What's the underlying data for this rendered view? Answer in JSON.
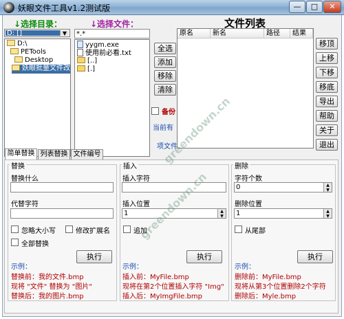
{
  "window": {
    "title": "妖眼文件工具v1.2测试版",
    "controls": {
      "minimize": "—",
      "maximize": "□",
      "close": "✕"
    }
  },
  "directory": {
    "label": "↓选择目录：",
    "drive": "D: []",
    "tree": [
      "D:\\",
      "PETools",
      "Desktop",
      "妖眼批量文件改名"
    ]
  },
  "files": {
    "label": "↓选择文件：",
    "filter": "*.*",
    "items": [
      "yygm.exe",
      "使用前必看.txt",
      "[..]",
      "[.]"
    ]
  },
  "middle_buttons": [
    "全选",
    "添加",
    "移除",
    "清除"
  ],
  "backup": {
    "label": "备份"
  },
  "current_label": "当前有",
  "current_label2": "项文件",
  "file_list": {
    "title": "文件列表",
    "columns": [
      "原名",
      "新名",
      "路径",
      "结果"
    ]
  },
  "right_buttons": [
    "移顶",
    "上移",
    "下移",
    "移底",
    "导出",
    "帮助",
    "关于",
    "退出"
  ],
  "tabs": [
    "简单替换",
    "列表替换",
    "文件编号"
  ],
  "replace": {
    "group": "替换",
    "replace_what": "替换什么",
    "replace_with": "代替字符",
    "ignore_case": "忽略大小写",
    "modify_ext": "修改扩展名",
    "replace_all": "全部替换",
    "exec": "执行",
    "example_title": "示例：",
    "ex1": "替换前：我的文件.bmp",
    "ex2": "现将 \"文件\" 替换为 \"图片\"",
    "ex3": "替换后：我的图片.bmp"
  },
  "insert": {
    "group": "插入",
    "chars": "插入字符",
    "position": "插入位置",
    "position_value": "1",
    "append": "追加",
    "exec": "执行",
    "example_title": "示例：",
    "ex1": "插入前：MyFile.bmp",
    "ex2": "现将在第2个位置插入字符 \"Img\"",
    "ex3": "插入后：MyImgFile.bmp"
  },
  "delete": {
    "group": "删除",
    "count": "字符个数",
    "count_value": "0",
    "position": "删除位置",
    "position_value": "1",
    "from_end": "从尾部",
    "exec": "执行",
    "example_title": "示例：",
    "ex1": "删除前：MyFile.bmp",
    "ex2": "现将从第3个位置删除2个字符",
    "ex3": "删除后：Myle.bmp"
  },
  "watermark": "greendown.cn"
}
